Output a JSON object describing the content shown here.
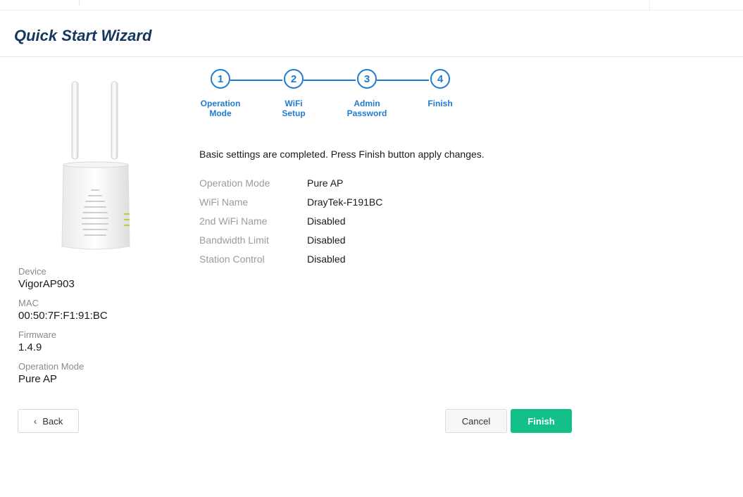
{
  "wizard": {
    "title": "Quick Start Wizard"
  },
  "steps": [
    {
      "number": "1",
      "label_line1": "Operation",
      "label_line2": "Mode"
    },
    {
      "number": "2",
      "label_line1": "WiFi",
      "label_line2": "Setup"
    },
    {
      "number": "3",
      "label_line1": "Admin",
      "label_line2": "Password"
    },
    {
      "number": "4",
      "label_line1": "Finish",
      "label_line2": ""
    }
  ],
  "device_info": {
    "device_label": "Device",
    "device_value": "VigorAP903",
    "mac_label": "MAC",
    "mac_value": "00:50:7F:F1:91:BC",
    "firmware_label": "Firmware",
    "firmware_value": "1.4.9",
    "mode_label": "Operation Mode",
    "mode_value": "Pure AP"
  },
  "message": "Basic settings are completed. Press Finish button apply changes.",
  "summary": [
    {
      "key": "Operation Mode",
      "value": "Pure AP"
    },
    {
      "key": "WiFi Name",
      "value": "DrayTek-F191BC"
    },
    {
      "key": "2nd WiFi Name",
      "value": "Disabled"
    },
    {
      "key": "Bandwidth Limit",
      "value": "Disabled"
    },
    {
      "key": "Station Control",
      "value": "Disabled"
    }
  ],
  "buttons": {
    "back": "Back",
    "cancel": "Cancel",
    "finish": "Finish"
  },
  "colors": {
    "accent": "#1f7cd0",
    "finish": "#14bf8a",
    "title": "#15365f"
  }
}
